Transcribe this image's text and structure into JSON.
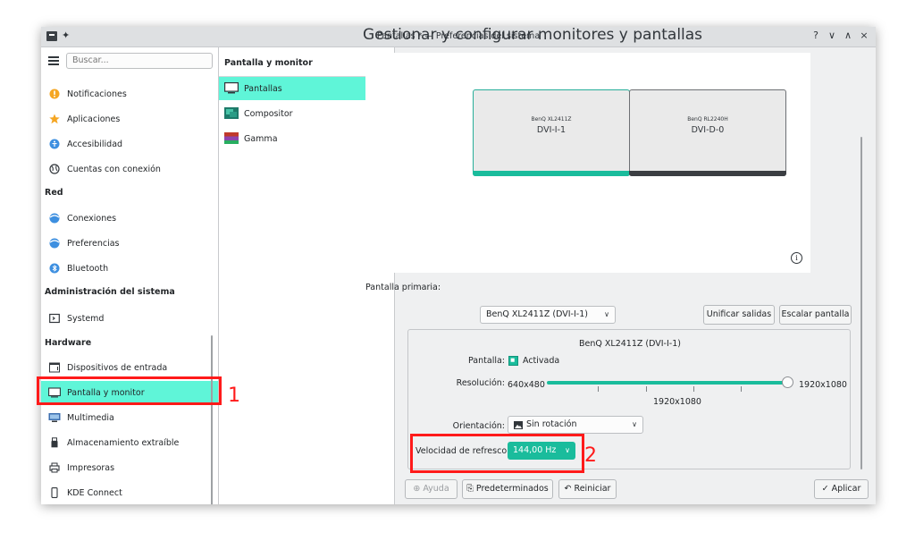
{
  "window": {
    "title": "Pantallas * — Preferencias del sistema",
    "controls": {
      "help": "?",
      "minimize": "∨",
      "maximize": "∧",
      "close": "×"
    }
  },
  "sidebar": {
    "search_placeholder": "Buscar...",
    "items": [
      {
        "label": "Notificaciones",
        "icon": "notification-icon",
        "color": "#f5a623"
      },
      {
        "label": "Aplicaciones",
        "icon": "star-icon",
        "color": "#f5a623"
      },
      {
        "label": "Accesibilidad",
        "icon": "accessibility-icon",
        "color": "#3d8fe0"
      },
      {
        "label": "Cuentas con conexión",
        "icon": "globe-icon",
        "color": "#31363b"
      },
      {
        "label": "Conexiones",
        "icon": "network-icon",
        "color": "#3d8fe0"
      },
      {
        "label": "Preferencias",
        "icon": "network-preferences-icon",
        "color": "#3d8fe0"
      },
      {
        "label": "Bluetooth",
        "icon": "bluetooth-icon",
        "color": "#3d8fe0"
      },
      {
        "label": "Systemd",
        "icon": "terminal-icon",
        "color": "#31363b"
      },
      {
        "label": "Dispositivos de entrada",
        "icon": "keyboard-icon",
        "color": "#31363b"
      },
      {
        "label": "Pantalla y monitor",
        "icon": "monitor-icon",
        "color": "#31363b"
      },
      {
        "label": "Multimedia",
        "icon": "multimedia-icon",
        "color": "#31363b"
      },
      {
        "label": "Almacenamiento extraíble",
        "icon": "usb-icon",
        "color": "#31363b"
      },
      {
        "label": "Impresoras",
        "icon": "printer-icon",
        "color": "#31363b"
      },
      {
        "label": "KDE Connect",
        "icon": "phone-icon",
        "color": "#31363b"
      }
    ],
    "sections": [
      "Red",
      "Administración del sistema",
      "Hardware"
    ]
  },
  "subnav": {
    "title": "Pantalla y monitor",
    "items": [
      "Pantallas",
      "Compositor",
      "Gamma"
    ]
  },
  "main": {
    "title": "Gestionar y configurar monitores y pantallas",
    "monitors": [
      {
        "model": "BenQ XL2411Z",
        "connector": "DVI-I-1"
      },
      {
        "model": "BenQ RL2240H",
        "connector": "DVI-D-0"
      }
    ],
    "info_icon": "i",
    "primary_label": "Pantalla primaria:",
    "primary_value": "BenQ XL2411Z (DVI-I-1)",
    "unify_button": "Unificar salidas",
    "scale_button": "Escalar pantalla",
    "panel": {
      "title": "BenQ XL2411Z (DVI-I-1)",
      "display_label": "Pantalla:",
      "display_value": "Activada",
      "resolution_label": "Resolución:",
      "resolution_min": "640x480",
      "resolution_max": "1920x1080",
      "resolution_current": "1920x1080",
      "orientation_label": "Orientación:",
      "orientation_value": "Sin rotación",
      "refresh_label": "Velocidad de refresco:",
      "refresh_value": "144,00 Hz"
    }
  },
  "footer": {
    "help": "Ayuda",
    "defaults": "Predeterminados",
    "reset": "Reiniciar",
    "apply": "Aplicar"
  },
  "annotations": [
    "1",
    "2"
  ]
}
